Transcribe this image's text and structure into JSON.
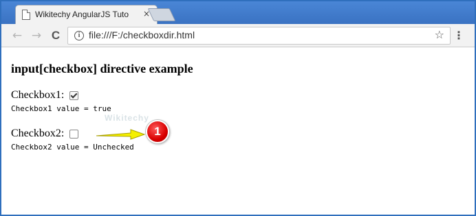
{
  "browser": {
    "tab": {
      "title": "Wikitechy AngularJS Tuto",
      "close_label": "×"
    },
    "address_bar": {
      "url": "file:///F:/checkboxdir.html"
    },
    "nav": {
      "back": "←",
      "forward": "→",
      "reload": "C",
      "menu": "⋮",
      "star": "☆"
    }
  },
  "page": {
    "title": "input[checkbox] directive example",
    "checkbox1": {
      "label": "Checkbox1:",
      "checked": true,
      "value_text": "Checkbox1 value = true"
    },
    "checkbox2": {
      "label": "Checkbox2:",
      "checked": false,
      "value_text": "Checkbox2 value = Unchecked"
    },
    "watermark": "Wikitechy",
    "annotation": {
      "number": "1"
    }
  },
  "colors": {
    "frame_border": "#2f6fbd",
    "tabstrip": "#3c78c8",
    "arrow": "#f5f000",
    "badge": "#d80000"
  },
  "icons": [
    "document-icon",
    "close-icon",
    "back-arrow-icon",
    "forward-arrow-icon",
    "reload-icon",
    "info-icon",
    "star-icon",
    "menu-icon",
    "pointer-arrow-icon"
  ]
}
